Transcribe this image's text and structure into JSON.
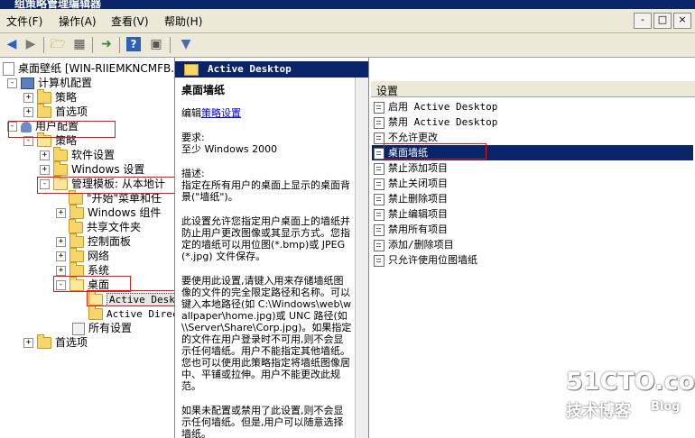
{
  "window": {
    "title": "组策略管理编辑器"
  },
  "menu": [
    "文件(F)",
    "操作(A)",
    "查看(V)",
    "帮助(H)"
  ],
  "mdi_buttons": [
    "-",
    "□",
    "×"
  ],
  "tree": {
    "root": "桌面壁纸 [WIN-RIIEMKNCMFB.TE",
    "computer_config": "计算机配置",
    "cc_policies": "策略",
    "cc_preferences": "首选项",
    "user_config": "用户配置",
    "uc_policies": "策略",
    "software_settings": "软件设置",
    "windows_settings": "Windows 设置",
    "admin_templates": "管理模板: 从本地计",
    "start_menu": "\"开始\"菜单和任",
    "windows_components": "Windows 组件",
    "shared_folders": "共享文件夹",
    "control_panel": "控制面板",
    "network": "网络",
    "system": "系统",
    "desktop": "桌面",
    "active_desktop": "Active Deskt",
    "active_directory": "Active Direc",
    "all_settings": "所有设置",
    "uc_preferences": "首选项"
  },
  "description": {
    "header": "Active Desktop",
    "title": "桌面墙纸",
    "edit_prefix": "编辑",
    "edit_link": "策略设置",
    "requirements_label": "要求:",
    "requirements_value": "至少 Windows 2000",
    "desc_label": "描述:",
    "p1": "指定在所有用户的桌面上显示的桌面背景(\"墙纸\")。",
    "p2": "此设置允许您指定用户桌面上的墙纸并防止用户更改图像或其显示方式。您指定的墙纸可以用位图(*.bmp)或 JPEG (*.jpg) 文件保存。",
    "p3": "要使用此设置,请键入用来存储墙纸图像的文件的完全限定路径和名称。可以键入本地路径(如 C:\\Windows\\web\\wallpaper\\home.jpg)或 UNC 路径(如 \\\\Server\\Share\\Corp.jpg)。如果指定的文件在用户登录时不可用,则不会显示任何墙纸。用户不能指定其他墙纸。您也可以使用此策略指定将墙纸图像居中、平铺或拉伸。用户不能更改此规范。",
    "p4": "如果未配置或禁用了此设置,则不会显示任何墙纸。但是,用户可以随意选择墙纸。"
  },
  "settings": {
    "column_header": "设置",
    "items": [
      "启用 Active Desktop",
      "禁用 Active Desktop",
      "不允许更改",
      "桌面墙纸",
      "禁止添加项目",
      "禁止关闭项目",
      "禁止删除项目",
      "禁止编辑项目",
      "禁用所有项目",
      "添加/删除项目",
      "只允许使用位图墙纸"
    ],
    "selected_index": 3
  },
  "watermark": {
    "site": "51CTO.com",
    "sub": "技术博客",
    "blog": "Blog"
  },
  "colors": {
    "selection": "#0a246a",
    "highlight_box": "#e01818",
    "folder": "#f6d56a"
  }
}
